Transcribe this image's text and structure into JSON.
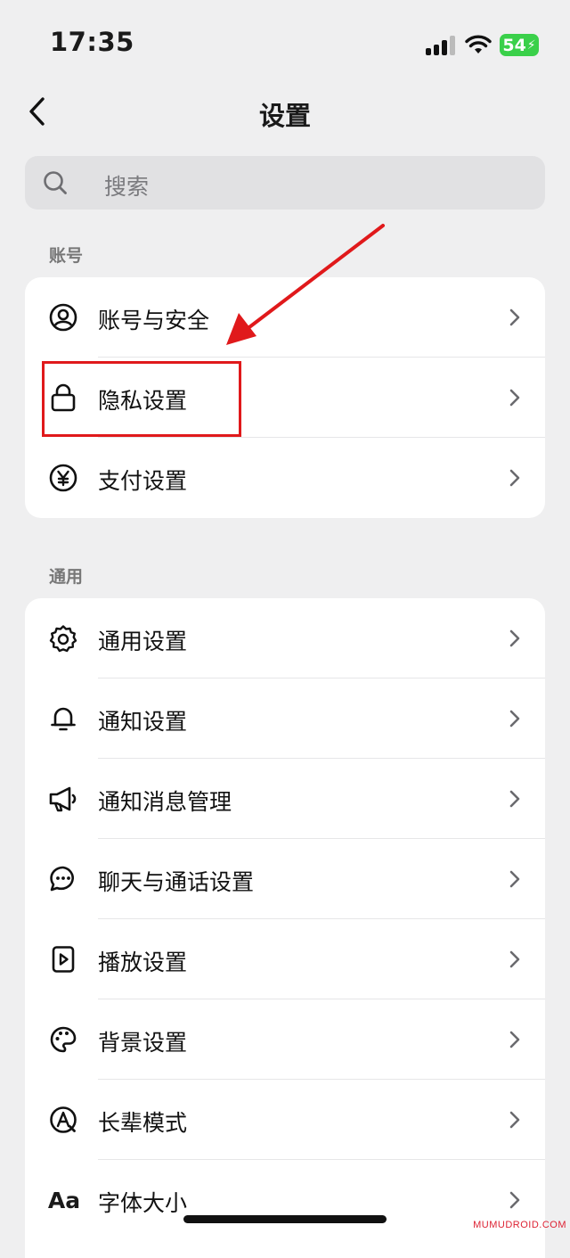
{
  "status_bar": {
    "time": "17:35",
    "battery": "54"
  },
  "nav": {
    "title": "设置"
  },
  "search": {
    "placeholder": "搜索"
  },
  "sections": {
    "account": {
      "label": "账号",
      "items": [
        {
          "label": "账号与安全",
          "icon": "user-circle-icon"
        },
        {
          "label": "隐私设置",
          "icon": "lock-icon"
        },
        {
          "label": "支付设置",
          "icon": "yen-icon"
        }
      ]
    },
    "general": {
      "label": "通用",
      "items": [
        {
          "label": "通用设置",
          "icon": "gear-icon"
        },
        {
          "label": "通知设置",
          "icon": "bell-icon"
        },
        {
          "label": "通知消息管理",
          "icon": "megaphone-icon"
        },
        {
          "label": "聊天与通话设置",
          "icon": "chat-bubble-icon"
        },
        {
          "label": "播放设置",
          "icon": "play-icon"
        },
        {
          "label": "背景设置",
          "icon": "palette-icon"
        },
        {
          "label": "长辈模式",
          "icon": "elder-mode-icon"
        },
        {
          "label": "字体大小",
          "icon": "font-size-icon",
          "glyph": "Aa"
        }
      ]
    }
  },
  "annotation": {
    "highlight_color": "#e0191b"
  },
  "watermark": "MUMUDROID.COM"
}
